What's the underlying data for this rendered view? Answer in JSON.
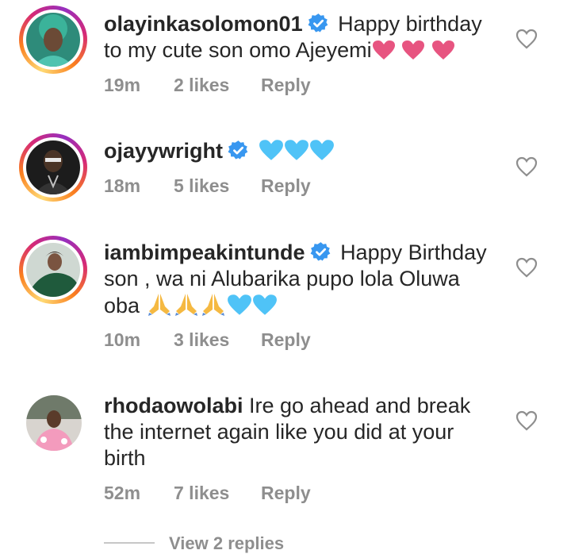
{
  "colors": {
    "pink_heart": "#e75480",
    "blue_heart": "#4fc3f7",
    "verified": "#3897f0",
    "meta": "#8e8e8e"
  },
  "comments": [
    {
      "username": "olayinkasolomon01",
      "verified": true,
      "text": "Happy birthday to my cute son omo Ajeyemi",
      "emojis": [
        "pink-heart",
        "pink-heart",
        "pink-heart"
      ],
      "time": "19m",
      "likes": "2 likes",
      "reply": "Reply"
    },
    {
      "username": "ojayywright",
      "verified": true,
      "text": "",
      "emojis": [
        "blue-heart",
        "blue-heart",
        "blue-heart"
      ],
      "time": "18m",
      "likes": "5 likes",
      "reply": "Reply"
    },
    {
      "username": "iambimpeakintunde",
      "verified": true,
      "text": "Happy Birthday son , wa ni Alubarika pupo lola Oluwa oba",
      "emojis": [
        "folded-hands",
        "folded-hands",
        "folded-hands",
        "blue-heart",
        "blue-heart"
      ],
      "time": "10m",
      "likes": "3 likes",
      "reply": "Reply"
    },
    {
      "username": "rhodaowolabi",
      "verified": false,
      "text": "Ire go ahead and break the internet again like you did at your birth",
      "emojis": [],
      "time": "52m",
      "likes": "7 likes",
      "reply": "Reply"
    }
  ],
  "view_replies": "View 2 replies"
}
